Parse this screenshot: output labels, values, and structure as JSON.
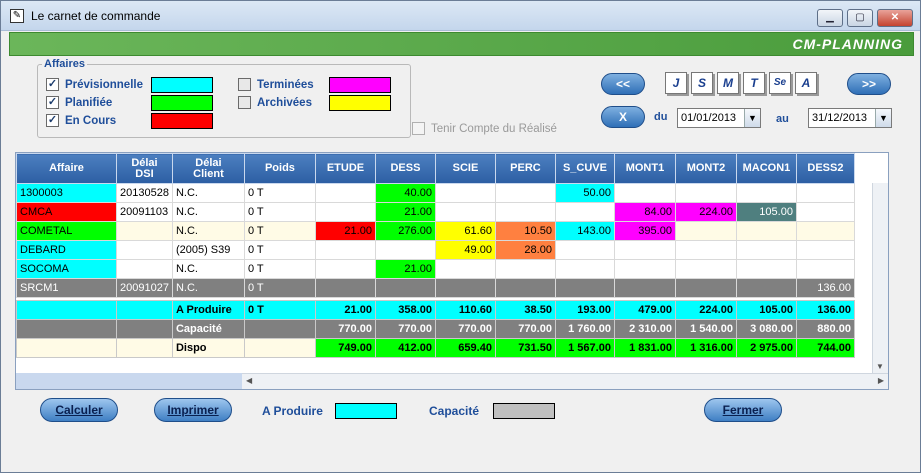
{
  "window": {
    "title": "Le carnet de commande",
    "banner": "CM-PLANNING"
  },
  "legend": {
    "title": "Affaires",
    "items": [
      {
        "label": "Prévisionnelle",
        "checked": true,
        "color": "#00ffff"
      },
      {
        "label": "Planifiée",
        "checked": true,
        "color": "#00ff00"
      },
      {
        "label": "En Cours",
        "checked": true,
        "color": "#ff0000"
      },
      {
        "label": "Terminées",
        "checked": false,
        "color": "#ff00ff"
      },
      {
        "label": "Archivées",
        "checked": false,
        "color": "#ffff00"
      }
    ]
  },
  "nav": {
    "prev": "<<",
    "next": ">>",
    "clear": "X",
    "letters": [
      "J",
      "S",
      "M",
      "T",
      "Se",
      "A"
    ],
    "du_label": "du",
    "du_value": "01/01/2013",
    "au_label": "au",
    "au_value": "31/12/2013",
    "tenir": "Tenir Compte du Réalisé"
  },
  "table": {
    "columns": [
      "Affaire",
      "Délai DSI",
      "Délai Client",
      "Poids",
      "ETUDE",
      "DESS",
      "SCIE",
      "PERC",
      "S_CUVE",
      "MONT1",
      "MONT2",
      "MACON1",
      "DESS2"
    ],
    "rows": [
      {
        "cells": [
          "1300003",
          "20130528",
          "N.C.",
          "0 T",
          "",
          "40.00",
          "",
          "",
          "50.00",
          "",
          "",
          "",
          ""
        ],
        "colors": [
          "#00ffff",
          "#ffffff",
          "#ffffff",
          "#ffffff",
          "#ffffff",
          "#00ff00",
          "#ffffff",
          "#ffffff",
          "#00ffff",
          "#ffffff",
          "#ffffff",
          "#ffffff",
          "#ffffff"
        ]
      },
      {
        "cells": [
          "CMCA",
          "20091103",
          "N.C.",
          "0 T",
          "",
          "21.00",
          "",
          "",
          "",
          "84.00",
          "224.00",
          "105.00",
          ""
        ],
        "colors": [
          "#ff0000",
          "#ffffff",
          "#ffffff",
          "#ffffff",
          "#ffffff",
          "#00ff00",
          "#ffffff",
          "#ffffff",
          "#ffffff",
          "#ff00ff",
          "#ff00ff",
          "#4f7f7f",
          "#ffffff"
        ]
      },
      {
        "cells": [
          "COMETAL",
          "",
          "N.C.",
          "0 T",
          "21.00",
          "276.00",
          "61.60",
          "10.50",
          "143.00",
          "395.00",
          "",
          "",
          ""
        ],
        "colors": [
          "#00ff00",
          "#fffbe6",
          "#fffbe6",
          "#fffbe6",
          "#ff0000",
          "#00ff00",
          "#ffff00",
          "#ff8040",
          "#00ffff",
          "#ff00ff",
          "#fffbe6",
          "#fffbe6",
          "#fffbe6"
        ]
      },
      {
        "cells": [
          "DEBARD",
          "",
          "(2005) S39",
          "0 T",
          "",
          "",
          "49.00",
          "28.00",
          "",
          "",
          "",
          "",
          ""
        ],
        "colors": [
          "#00ffff",
          "#ffffff",
          "#ffffff",
          "#ffffff",
          "#ffffff",
          "#ffffff",
          "#ffff00",
          "#ff8040",
          "#ffffff",
          "#ffffff",
          "#ffffff",
          "#ffffff",
          "#ffffff"
        ]
      },
      {
        "cells": [
          "SOCOMA",
          "",
          "N.C.",
          "0 T",
          "",
          "21.00",
          "",
          "",
          "",
          "",
          "",
          "",
          ""
        ],
        "colors": [
          "#00ffff",
          "#ffffff",
          "#ffffff",
          "#ffffff",
          "#ffffff",
          "#00ff00",
          "#ffffff",
          "#ffffff",
          "#ffffff",
          "#ffffff",
          "#ffffff",
          "#ffffff",
          "#ffffff"
        ]
      },
      {
        "cells": [
          "SRCM1",
          "20091027",
          "N.C.",
          "0 T",
          "",
          "",
          "",
          "",
          "",
          "",
          "",
          "",
          "136.00"
        ],
        "colors": [
          "#808080",
          "#808080",
          "#808080",
          "#808080",
          "#808080",
          "#808080",
          "#808080",
          "#808080",
          "#808080",
          "#808080",
          "#808080",
          "#808080",
          "#808080"
        ]
      }
    ],
    "summary": [
      {
        "label": "A Produire",
        "poids": "0 T",
        "values": [
          "21.00",
          "358.00",
          "110.60",
          "38.50",
          "193.00",
          "479.00",
          "224.00",
          "105.00",
          "136.00"
        ],
        "color": "#00ffff"
      },
      {
        "label": "Capacité",
        "poids": "",
        "values": [
          "770.00",
          "770.00",
          "770.00",
          "770.00",
          "1 760.00",
          "2 310.00",
          "1 540.00",
          "3 080.00",
          "880.00"
        ],
        "color": "#808080"
      },
      {
        "label": "Dispo",
        "poids": "",
        "values": [
          "749.00",
          "412.00",
          "659.40",
          "731.50",
          "1 567.00",
          "1 831.00",
          "1 316.00",
          "2 975.00",
          "744.00"
        ],
        "color": "#00ff00"
      }
    ]
  },
  "footer": {
    "calculer": "Calculer",
    "imprimer": "Imprimer",
    "fermer": "Fermer",
    "a_produire": "A Produire",
    "capacite": "Capacité",
    "a_produire_color": "#00ffff",
    "capacite_color": "#c0c0c0"
  }
}
